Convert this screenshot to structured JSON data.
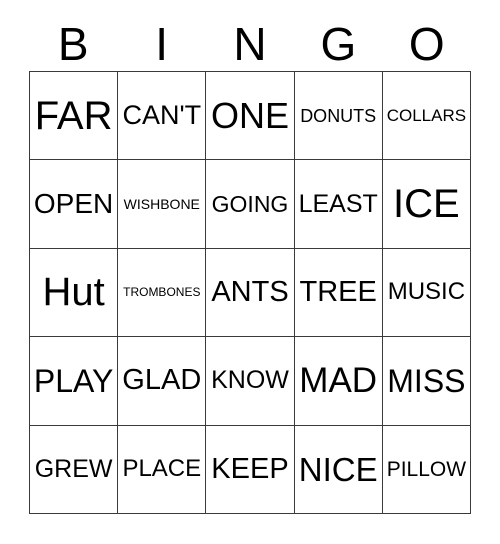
{
  "header": {
    "letters": [
      "B",
      "I",
      "N",
      "G",
      "O"
    ]
  },
  "grid": {
    "columns": 5,
    "rows": 5,
    "cells": [
      [
        {
          "text": "FAR",
          "size_class": "len-3"
        },
        {
          "text": "CAN'T",
          "size_class": "len-5"
        },
        {
          "text": "ONE",
          "size_class": "len-3"
        },
        {
          "text": "DONUTS",
          "size_class": "len-6"
        },
        {
          "text": "COLLARS",
          "size_class": "len-7"
        }
      ],
      [
        {
          "text": "OPEN",
          "size_class": "len-4"
        },
        {
          "text": "WISHBONE",
          "size_class": "len-8"
        },
        {
          "text": "GOING",
          "size_class": "len-5"
        },
        {
          "text": "LEAST",
          "size_class": "len-5"
        },
        {
          "text": "ICE",
          "size_class": "len-3"
        }
      ],
      [
        {
          "text": "Hut",
          "size_class": "len-3"
        },
        {
          "text": "TROMBONES",
          "size_class": "len-9"
        },
        {
          "text": "ANTS",
          "size_class": "len-4"
        },
        {
          "text": "TREE",
          "size_class": "len-4"
        },
        {
          "text": "MUSIC",
          "size_class": "len-5"
        }
      ],
      [
        {
          "text": "PLAY",
          "size_class": "len-4"
        },
        {
          "text": "GLAD",
          "size_class": "len-4"
        },
        {
          "text": "KNOW",
          "size_class": "len-5"
        },
        {
          "text": "MAD",
          "size_class": "len-3"
        },
        {
          "text": "MISS",
          "size_class": "len-4"
        }
      ],
      [
        {
          "text": "GREW",
          "size_class": "len-5"
        },
        {
          "text": "PLACE",
          "size_class": "len-5"
        },
        {
          "text": "KEEP",
          "size_class": "len-4"
        },
        {
          "text": "NICE",
          "size_class": "len-4"
        },
        {
          "text": "PILLOW",
          "size_class": "len-6"
        }
      ]
    ]
  },
  "colors": {
    "background": "#ffffff",
    "text": "#000000",
    "grid_line": "#3a3a3a"
  }
}
